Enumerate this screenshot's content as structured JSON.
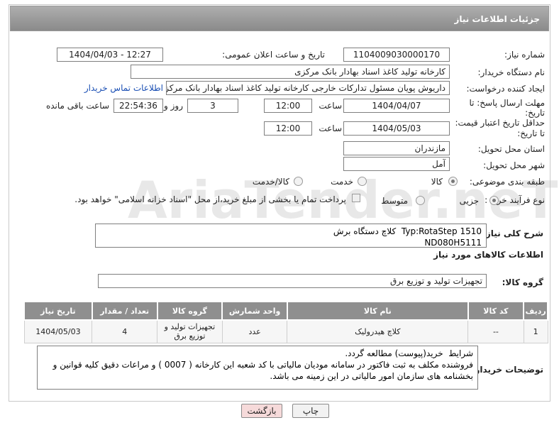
{
  "header": {
    "title": "جزئیات اطلاعات نیاز"
  },
  "form": {
    "need_number_label": "شماره نیاز:",
    "need_number": "1104009030000170",
    "announce_label": "تاریخ و ساعت اعلان عمومی:",
    "announce_value": "1404/04/03 - 12:27",
    "buyer_label": "نام دستگاه خریدار:",
    "buyer_value": "کارخانه تولید کاغذ اسناد بهادار بانک مرکزی",
    "creator_label": "ایجاد کننده درخواست:",
    "creator_value": "داریوش  پویان مسئول تدارکات خارجی کارخانه تولید کاغذ اسناد بهادار بانک مرکزی",
    "contact_link": "اطلاعات تماس خریدار",
    "deadline_label_1": "مهلت ارسال پاسخ: تا",
    "deadline_label_2": "تاریخ:",
    "deadline_date": "1404/04/07",
    "time_label": "ساعت",
    "deadline_time": "12:00",
    "days_value": "3",
    "days_label": "روز و",
    "remaining_time": "22:54:36",
    "remaining_label": "ساعت باقی مانده",
    "validity_label_1": "حداقل تاریخ اعتبار قیمت:",
    "validity_label_2": "تا تاریخ:",
    "validity_date": "1404/05/03",
    "validity_time": "12:00",
    "province_label": "استان محل تحویل:",
    "province_value": "مازندران",
    "city_label": "شهر محل تحویل:",
    "city_value": "آمل",
    "category_label": "طبقه بندی موضوعی:",
    "category_options": [
      "کالا",
      "خدمت",
      "کالا/خدمت"
    ],
    "category_selected": "کالا",
    "process_label": "نوع فرآیند خرید :",
    "process_options": [
      "جزیی",
      "متوسط"
    ],
    "process_selected": "جزیی",
    "payment_note": "پرداخت تمام یا بخشی از مبلغ خرید،از محل \"اسناد خزانه اسلامی\" خواهد بود."
  },
  "description": {
    "label": "شرح کلی نیاز:",
    "text": "Typ:RotaStep 1510  کلاچ دستگاه برش\nND080H5111"
  },
  "goods": {
    "section_title": "اطلاعات کالاهای مورد نیاز",
    "group_label": "گروه کالا:",
    "group_value": "تجهیزات تولید و توزیع برق",
    "columns": [
      "ردیف",
      "کد کالا",
      "نام کالا",
      "واحد شمارش",
      "گروه کالا",
      "تعداد / مقدار",
      "تاریخ نیاز"
    ],
    "rows": [
      [
        "1",
        "--",
        "کلاچ هیدرولیک",
        "عدد",
        "تجهیزات تولید و توزیع برق",
        "4",
        "1404/05/03"
      ]
    ]
  },
  "buyer_notes": {
    "label": "توضیحات خریدار:",
    "text": "شرایط  خرید(پیوست) مطالعه گردد.\nفروشنده مکلف به ثبت فاکتور در سامانه مودیان مالیاتی با کد شعبه این کارخانه ( 0007 ) و مراعات دقیق کلیه قوانین و بخشنامه های سازمان امور مالیاتی در این زمینه می باشد."
  },
  "buttons": {
    "print": "چاپ",
    "back": "بازگشت"
  },
  "watermark": "AriaTender.neT",
  "colors": {
    "header_bg": "#999999",
    "link": "#1a4fb4",
    "back_button_bg": "#f6dada"
  }
}
